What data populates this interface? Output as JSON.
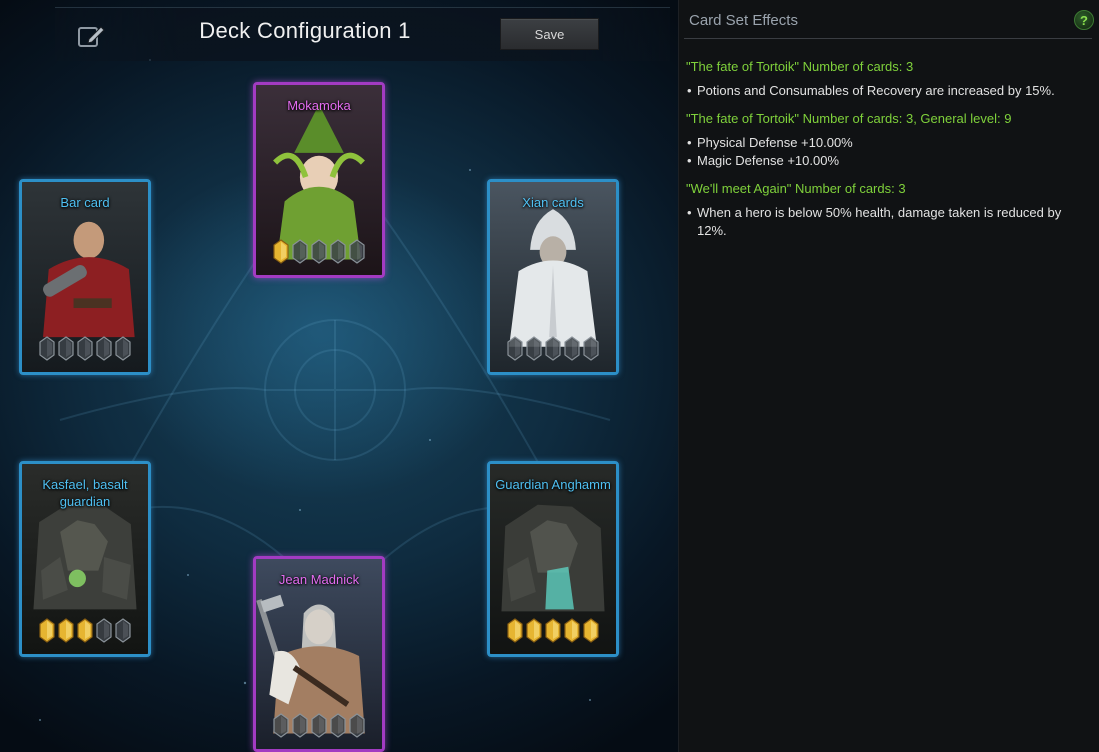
{
  "deck": {
    "title": "Deck Configuration 1",
    "save_label": "Save",
    "edit_icon": "edit-pencil-icon"
  },
  "cards": [
    {
      "name": "Mokamoka",
      "rarity": "purple",
      "filled_gems": 1,
      "total_gems": 5
    },
    {
      "name": "Bar card",
      "rarity": "blue",
      "filled_gems": 0,
      "total_gems": 5
    },
    {
      "name": "Xian cards",
      "rarity": "blue",
      "filled_gems": 0,
      "total_gems": 5
    },
    {
      "name": "Kasfael, basalt guardian",
      "rarity": "blue",
      "filled_gems": 3,
      "total_gems": 5
    },
    {
      "name": "Guardian Anghamm",
      "rarity": "blue",
      "filled_gems": 5,
      "total_gems": 5
    },
    {
      "name": "Jean Madnick",
      "rarity": "purple",
      "filled_gems": 0,
      "total_gems": 5
    }
  ],
  "effects": {
    "title": "Card Set Effects",
    "help_label": "?",
    "groups": [
      {
        "title": "\"The fate of Tortoik\" Number of cards: 3",
        "bullets": [
          "Potions and Consumables of Recovery are increased by 15%."
        ]
      },
      {
        "title": "\"The fate of Tortoik\" Number of cards: 3, General level: 9",
        "bullets": [
          "Physical Defense +10.00%",
          "Magic Defense +10.00%"
        ]
      },
      {
        "title": "\"We'll meet Again\" Number of cards: 3",
        "bullets": [
          "When a hero is below 50% health, damage taken is reduced by 12%."
        ]
      }
    ]
  },
  "colors": {
    "effect_title": "#7fd13b",
    "blue_card_name": "#4fc0f2",
    "purple_card_name": "#e36cf0",
    "gem_filled": "#e6b531"
  }
}
